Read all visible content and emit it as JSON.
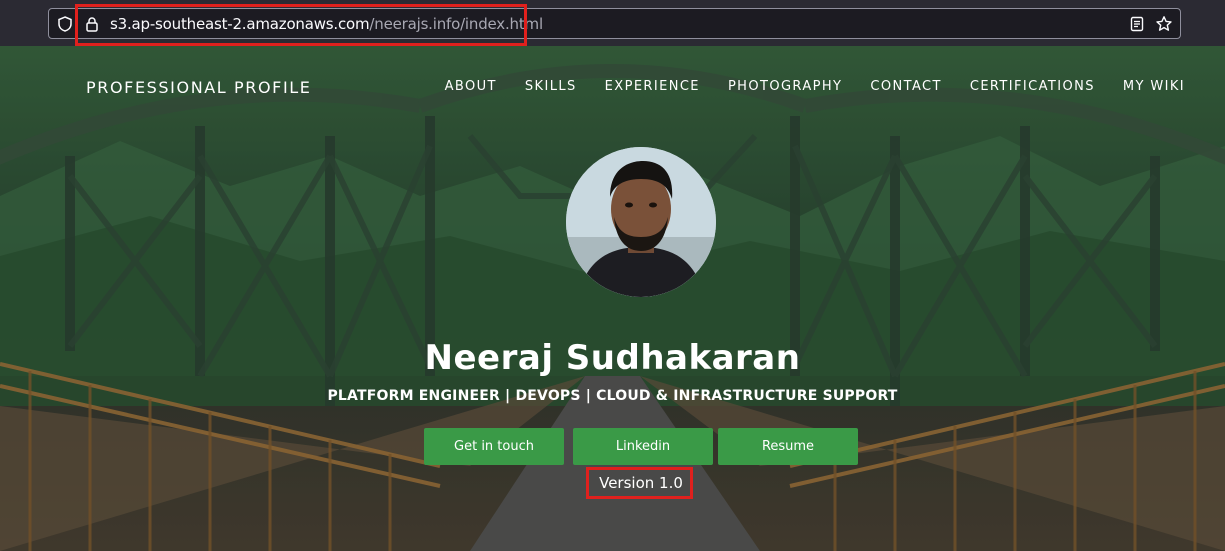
{
  "browser": {
    "url_host": "s3.ap-southeast-2.amazonaws.com",
    "url_path": "/neerajs.info/index.html",
    "icons": [
      "shield-icon",
      "lock-icon",
      "reader-view-icon",
      "bookmark-star-icon"
    ],
    "annotation_color": "#e0201d"
  },
  "header": {
    "brand": "PROFESSIONAL PROFILE",
    "nav": [
      "ABOUT",
      "SKILLS",
      "EXPERIENCE",
      "PHOTOGRAPHY",
      "CONTACT",
      "CERTIFICATIONS",
      "MY WIKI"
    ]
  },
  "profile": {
    "name": "Neeraj Sudhakaran",
    "title": "PLATFORM ENGINEER | DEVOPS | CLOUD & INFRASTRUCTURE SUPPORT",
    "buttons": [
      "Get in touch",
      "Linkedin",
      "Resume"
    ],
    "version": "Version 1.0"
  },
  "colors": {
    "button": "#3a9a47",
    "text": "#ffffff"
  }
}
